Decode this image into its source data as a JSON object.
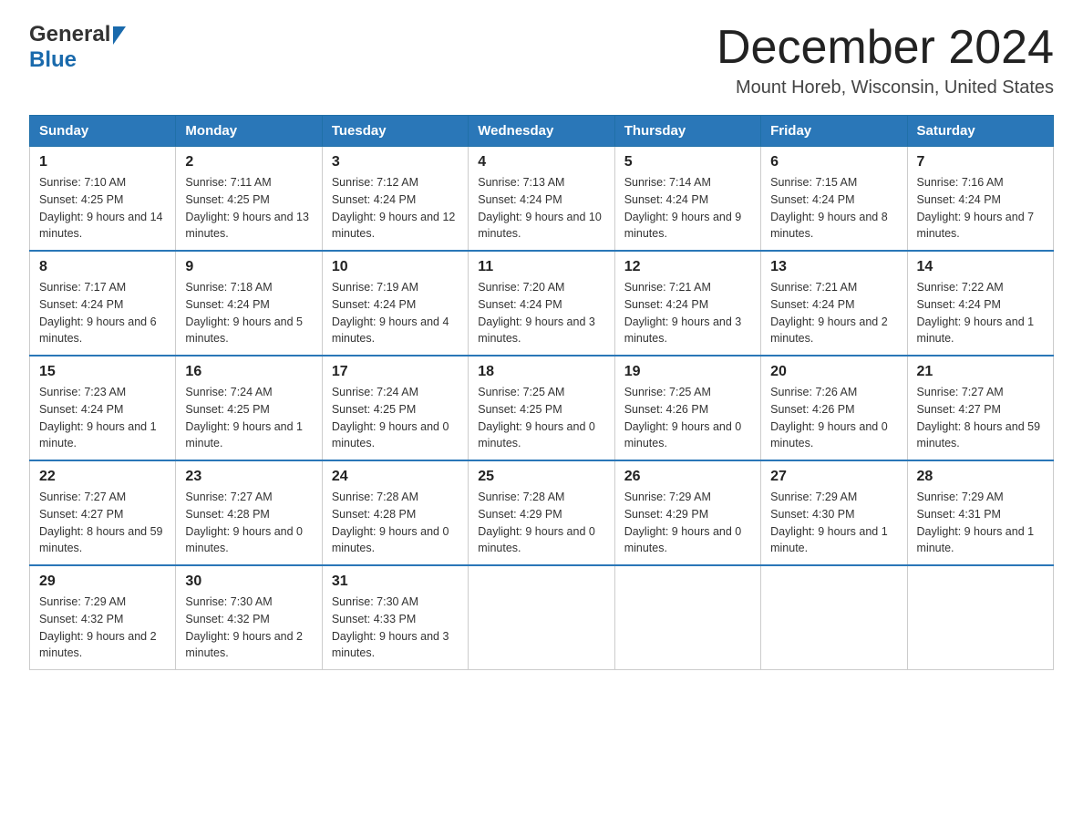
{
  "header": {
    "logo_general": "General",
    "logo_blue": "Blue",
    "month_title": "December 2024",
    "location": "Mount Horeb, Wisconsin, United States"
  },
  "weekdays": [
    "Sunday",
    "Monday",
    "Tuesday",
    "Wednesday",
    "Thursday",
    "Friday",
    "Saturday"
  ],
  "weeks": [
    [
      {
        "day": "1",
        "sunrise": "7:10 AM",
        "sunset": "4:25 PM",
        "daylight": "9 hours and 14 minutes."
      },
      {
        "day": "2",
        "sunrise": "7:11 AM",
        "sunset": "4:25 PM",
        "daylight": "9 hours and 13 minutes."
      },
      {
        "day": "3",
        "sunrise": "7:12 AM",
        "sunset": "4:24 PM",
        "daylight": "9 hours and 12 minutes."
      },
      {
        "day": "4",
        "sunrise": "7:13 AM",
        "sunset": "4:24 PM",
        "daylight": "9 hours and 10 minutes."
      },
      {
        "day": "5",
        "sunrise": "7:14 AM",
        "sunset": "4:24 PM",
        "daylight": "9 hours and 9 minutes."
      },
      {
        "day": "6",
        "sunrise": "7:15 AM",
        "sunset": "4:24 PM",
        "daylight": "9 hours and 8 minutes."
      },
      {
        "day": "7",
        "sunrise": "7:16 AM",
        "sunset": "4:24 PM",
        "daylight": "9 hours and 7 minutes."
      }
    ],
    [
      {
        "day": "8",
        "sunrise": "7:17 AM",
        "sunset": "4:24 PM",
        "daylight": "9 hours and 6 minutes."
      },
      {
        "day": "9",
        "sunrise": "7:18 AM",
        "sunset": "4:24 PM",
        "daylight": "9 hours and 5 minutes."
      },
      {
        "day": "10",
        "sunrise": "7:19 AM",
        "sunset": "4:24 PM",
        "daylight": "9 hours and 4 minutes."
      },
      {
        "day": "11",
        "sunrise": "7:20 AM",
        "sunset": "4:24 PM",
        "daylight": "9 hours and 3 minutes."
      },
      {
        "day": "12",
        "sunrise": "7:21 AM",
        "sunset": "4:24 PM",
        "daylight": "9 hours and 3 minutes."
      },
      {
        "day": "13",
        "sunrise": "7:21 AM",
        "sunset": "4:24 PM",
        "daylight": "9 hours and 2 minutes."
      },
      {
        "day": "14",
        "sunrise": "7:22 AM",
        "sunset": "4:24 PM",
        "daylight": "9 hours and 1 minute."
      }
    ],
    [
      {
        "day": "15",
        "sunrise": "7:23 AM",
        "sunset": "4:24 PM",
        "daylight": "9 hours and 1 minute."
      },
      {
        "day": "16",
        "sunrise": "7:24 AM",
        "sunset": "4:25 PM",
        "daylight": "9 hours and 1 minute."
      },
      {
        "day": "17",
        "sunrise": "7:24 AM",
        "sunset": "4:25 PM",
        "daylight": "9 hours and 0 minutes."
      },
      {
        "day": "18",
        "sunrise": "7:25 AM",
        "sunset": "4:25 PM",
        "daylight": "9 hours and 0 minutes."
      },
      {
        "day": "19",
        "sunrise": "7:25 AM",
        "sunset": "4:26 PM",
        "daylight": "9 hours and 0 minutes."
      },
      {
        "day": "20",
        "sunrise": "7:26 AM",
        "sunset": "4:26 PM",
        "daylight": "9 hours and 0 minutes."
      },
      {
        "day": "21",
        "sunrise": "7:27 AM",
        "sunset": "4:27 PM",
        "daylight": "8 hours and 59 minutes."
      }
    ],
    [
      {
        "day": "22",
        "sunrise": "7:27 AM",
        "sunset": "4:27 PM",
        "daylight": "8 hours and 59 minutes."
      },
      {
        "day": "23",
        "sunrise": "7:27 AM",
        "sunset": "4:28 PM",
        "daylight": "9 hours and 0 minutes."
      },
      {
        "day": "24",
        "sunrise": "7:28 AM",
        "sunset": "4:28 PM",
        "daylight": "9 hours and 0 minutes."
      },
      {
        "day": "25",
        "sunrise": "7:28 AM",
        "sunset": "4:29 PM",
        "daylight": "9 hours and 0 minutes."
      },
      {
        "day": "26",
        "sunrise": "7:29 AM",
        "sunset": "4:29 PM",
        "daylight": "9 hours and 0 minutes."
      },
      {
        "day": "27",
        "sunrise": "7:29 AM",
        "sunset": "4:30 PM",
        "daylight": "9 hours and 1 minute."
      },
      {
        "day": "28",
        "sunrise": "7:29 AM",
        "sunset": "4:31 PM",
        "daylight": "9 hours and 1 minute."
      }
    ],
    [
      {
        "day": "29",
        "sunrise": "7:29 AM",
        "sunset": "4:32 PM",
        "daylight": "9 hours and 2 minutes."
      },
      {
        "day": "30",
        "sunrise": "7:30 AM",
        "sunset": "4:32 PM",
        "daylight": "9 hours and 2 minutes."
      },
      {
        "day": "31",
        "sunrise": "7:30 AM",
        "sunset": "4:33 PM",
        "daylight": "9 hours and 3 minutes."
      },
      null,
      null,
      null,
      null
    ]
  ],
  "sunrise_label": "Sunrise:",
  "sunset_label": "Sunset:",
  "daylight_label": "Daylight:"
}
